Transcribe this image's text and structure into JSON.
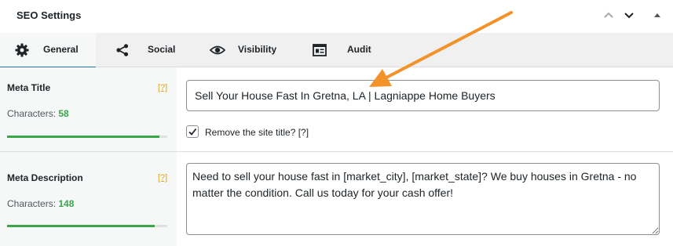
{
  "header": {
    "title": "SEO Settings",
    "buttons": [
      {
        "name": "move-up",
        "icon": "chevron-up-icon"
      },
      {
        "name": "move-down",
        "icon": "chevron-down-icon"
      },
      {
        "name": "toggle-panel",
        "icon": "caret-up-icon"
      }
    ]
  },
  "tabs": [
    {
      "label": "General",
      "icon": "gear-icon",
      "active": true
    },
    {
      "label": "Social",
      "icon": "share-icon",
      "active": false
    },
    {
      "label": "Visibility",
      "icon": "eye-icon",
      "active": false
    },
    {
      "label": "Audit",
      "icon": "audit-icon",
      "active": false
    }
  ],
  "meta_title": {
    "label": "Meta Title",
    "help": "[?]",
    "characters_label": "Characters:",
    "characters_count": "58",
    "progress_percent": 95,
    "value": "Sell Your House Fast In Gretna, LA | Lagniappe Home Buyers",
    "remove_site_title_label": "Remove the site title? [?]",
    "remove_site_title_checked": true
  },
  "meta_description": {
    "label": "Meta Description",
    "help": "[?]",
    "characters_label": "Characters:",
    "characters_count": "148",
    "progress_percent": 92,
    "value": "Need to sell your house fast in [market_city], [market_state]? We buy houses in Gretna - no matter the condition. Call us today for your cash offer!"
  },
  "colors": {
    "accent": "#2271b1",
    "success": "#3ba54a",
    "help_link": "#dba617",
    "annotation_arrow": "#f4922a"
  }
}
